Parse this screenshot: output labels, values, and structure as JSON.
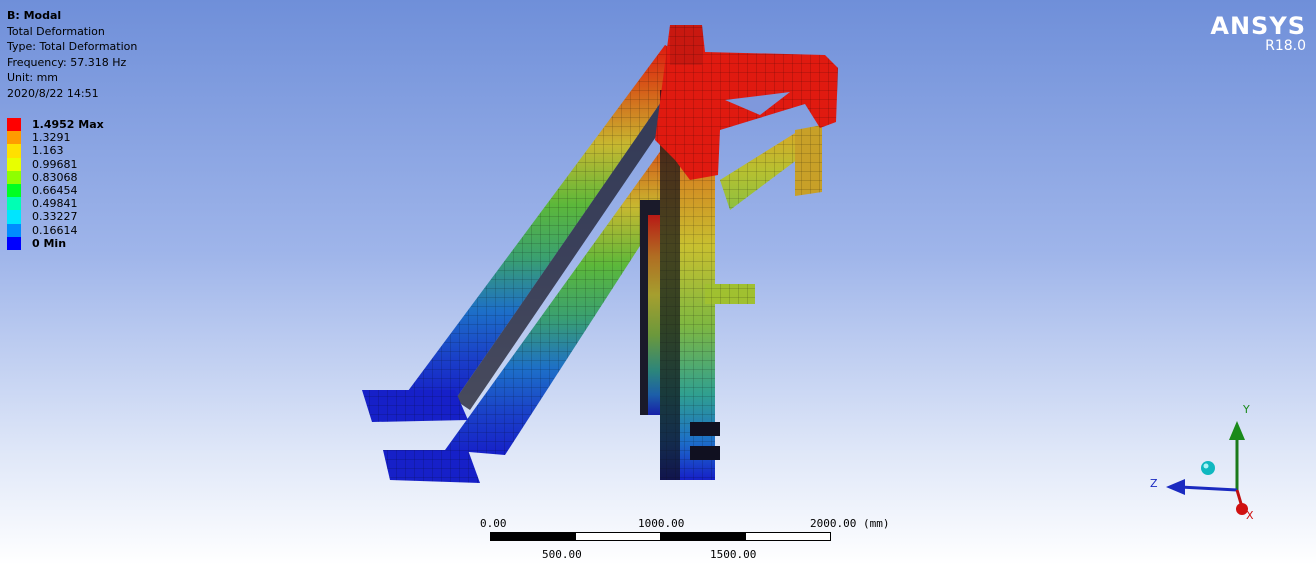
{
  "header": {
    "title": "B: Modal",
    "line1": "Total Deformation",
    "line2": "Type: Total Deformation",
    "line3": "Frequency: 57.318 Hz",
    "line4": "Unit: mm",
    "line5": "2020/8/22 14:51"
  },
  "legend": {
    "entries": [
      {
        "label": "1.4952 Max",
        "color": "#ff0000"
      },
      {
        "label": "1.3291",
        "color": "#ff9b00"
      },
      {
        "label": "1.163",
        "color": "#ffe000"
      },
      {
        "label": "0.99681",
        "color": "#e8ff00"
      },
      {
        "label": "0.83068",
        "color": "#8fff00"
      },
      {
        "label": "0.66454",
        "color": "#00ff22"
      },
      {
        "label": "0.49841",
        "color": "#00ffb4"
      },
      {
        "label": "0.33227",
        "color": "#00e5ff"
      },
      {
        "label": "0.16614",
        "color": "#008cff"
      },
      {
        "label": "0 Min",
        "color": "#0000ff"
      }
    ]
  },
  "brand": {
    "logo": "ANSYS",
    "version": "R18.0"
  },
  "triad": {
    "y_label": "Y",
    "z_label": "Z",
    "x_label": "X"
  },
  "scale": {
    "top_labels": [
      "0.00",
      "1000.00",
      "2000.00 (mm)"
    ],
    "bottom_labels": [
      "500.00",
      "1500.00"
    ]
  },
  "colors": {
    "max": "#e01a10",
    "high": "#d4a020",
    "mid": "#c8c828",
    "midlow": "#5cb83a",
    "low": "#2aa890",
    "lower": "#1d6fc8",
    "min": "#1620c8"
  }
}
